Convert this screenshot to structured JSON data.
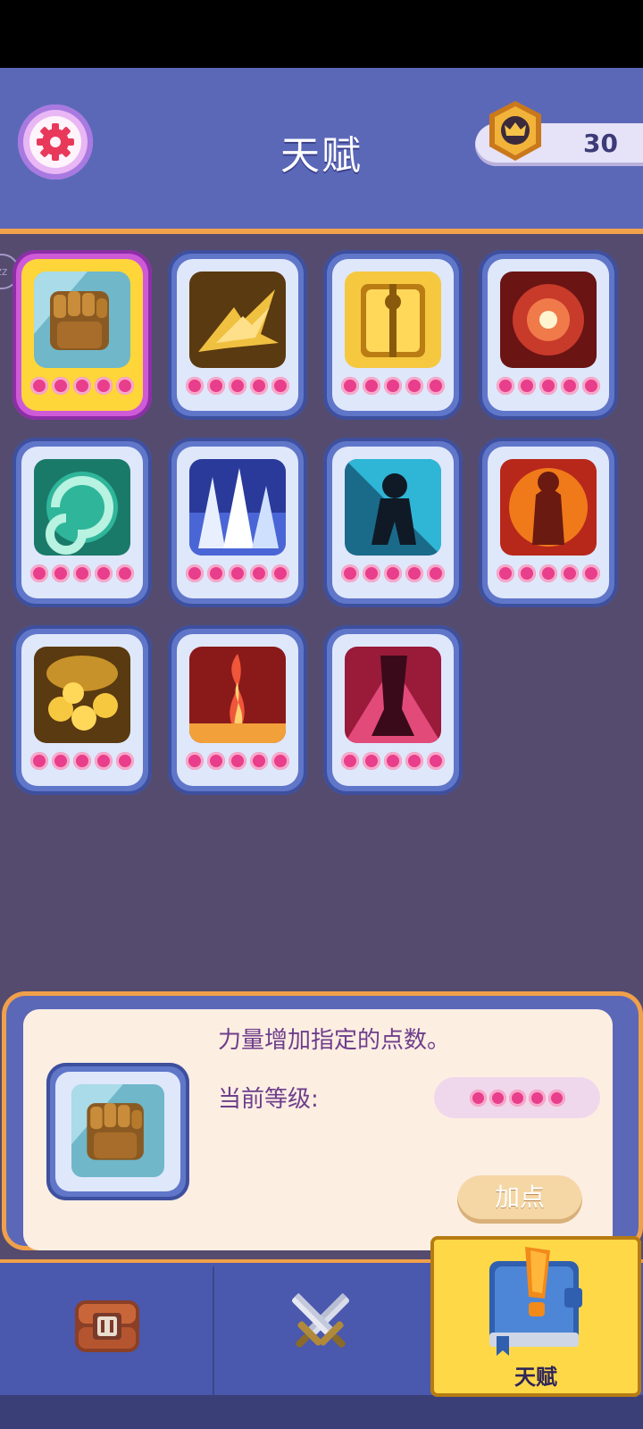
{
  "header": {
    "title": "天赋",
    "coins": "30"
  },
  "talents": [
    {
      "id": "strength",
      "selected": true,
      "art": "fist"
    },
    {
      "id": "agility",
      "selected": false,
      "art": "eagle"
    },
    {
      "id": "guard",
      "selected": false,
      "art": "shield"
    },
    {
      "id": "burst",
      "selected": false,
      "art": "orb"
    },
    {
      "id": "vortex",
      "selected": false,
      "art": "swirl"
    },
    {
      "id": "ice",
      "selected": false,
      "art": "ice"
    },
    {
      "id": "shadow",
      "selected": false,
      "art": "shadow"
    },
    {
      "id": "rage",
      "selected": false,
      "art": "rage"
    },
    {
      "id": "gold",
      "selected": false,
      "art": "coins"
    },
    {
      "id": "flame",
      "selected": false,
      "art": "flame"
    },
    {
      "id": "blood",
      "selected": false,
      "art": "blood"
    }
  ],
  "detail": {
    "description": "力量增加指定的点数。",
    "level_label": "当前等级:",
    "add_button": "加点"
  },
  "nav": {
    "active_label": "天赋"
  },
  "colors": {
    "accent": "#f0a04a",
    "header": "#5b68b8",
    "background": "#544b6e",
    "star": "#e83e8c"
  }
}
